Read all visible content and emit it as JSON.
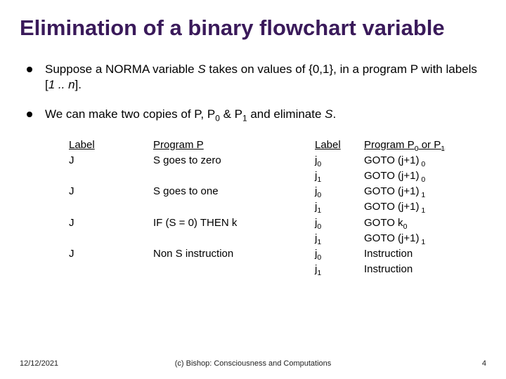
{
  "title": "Elimination of a binary flowchart variable",
  "bullets": {
    "b1_pre": "Suppose a NORMA variable ",
    "b1_s": "S",
    "b1_mid": " takes on values of {0,1}, in a program P with labels [",
    "b1_range": "1 .. n",
    "b1_post": "].",
    "b2_pre": "We can make two copies of P, P",
    "b2_s0": "0",
    "b2_amp": " & P",
    "b2_s1": "1",
    "b2_post": " and eliminate ",
    "b2_s": "S",
    "b2_dot": "."
  },
  "headers": {
    "h1": "Label",
    "h2": "Program P",
    "h3": "Label",
    "h4_pre": "Program P",
    "h4_s0": "0",
    "h4_or": " or P",
    "h4_s1": "1"
  },
  "rows": [
    {
      "c1": "J",
      "c2": "S goes to zero",
      "c3": "j",
      "c3s": "0",
      "c4": "GOTO (j+1)",
      "c4s": " 0"
    },
    {
      "c1": "",
      "c2": "",
      "c3": "j",
      "c3s": "1",
      "c4": "GOTO (j+1)",
      "c4s": " 0"
    },
    {
      "c1": "J",
      "c2": "S goes to one",
      "c3": "j",
      "c3s": "0",
      "c4": "GOTO (j+1)",
      "c4s": " 1"
    },
    {
      "c1": "",
      "c2": "",
      "c3": "j",
      "c3s": "1",
      "c4": "GOTO (j+1)",
      "c4s": " 1"
    },
    {
      "c1": "J",
      "c2": "IF (S = 0) THEN k",
      "c3": "j",
      "c3s": "0",
      "c4": "GOTO k",
      "c4s": "0"
    },
    {
      "c1": "",
      "c2": "",
      "c3": "j",
      "c3s": "1",
      "c4": "GOTO (j+1)",
      "c4s": " 1"
    },
    {
      "c1": "J",
      "c2": "Non S instruction",
      "c3": "j",
      "c3s": "0",
      "c4": "Instruction",
      "c4s": ""
    },
    {
      "c1": "",
      "c2": "",
      "c3": "j",
      "c3s": "1",
      "c4": "Instruction",
      "c4s": ""
    }
  ],
  "footer": {
    "date": "12/12/2021",
    "credit": "(c) Bishop: Consciousness and Computations",
    "page": "4"
  }
}
